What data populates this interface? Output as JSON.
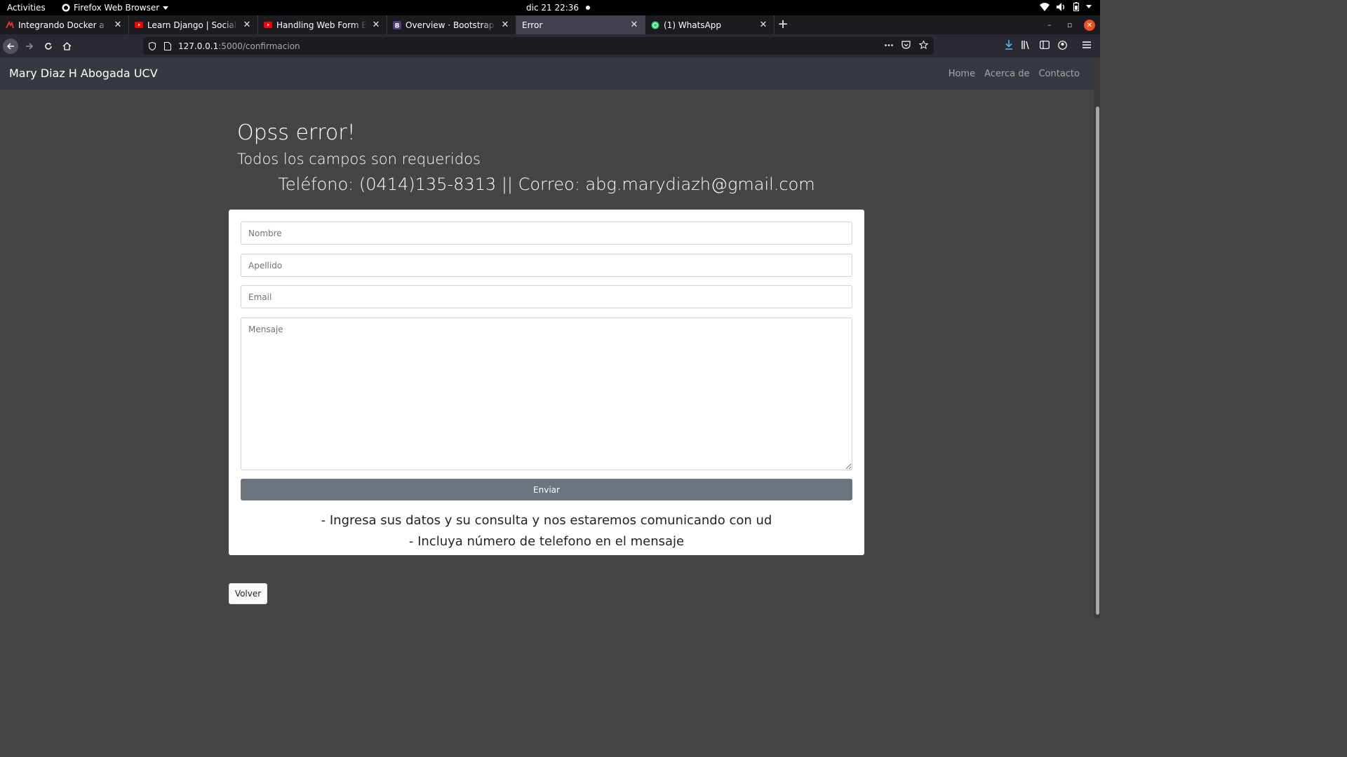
{
  "system": {
    "activities": "Activities",
    "app_name": "Firefox Web Browser",
    "clock": "dic 21  22:36"
  },
  "tabs": [
    {
      "title": "Integrando Docker a su I",
      "favicon": "c-red-logo-icon",
      "active": false
    },
    {
      "title": "Learn Django | Social Ne",
      "favicon": "youtube-icon",
      "active": false
    },
    {
      "title": "Handling Web Form Erro",
      "favicon": "youtube-icon",
      "active": false
    },
    {
      "title": "Overview · Bootstrap",
      "favicon": "bootstrap-icon",
      "active": false
    },
    {
      "title": "Error",
      "favicon": "",
      "active": true
    },
    {
      "title": "(1) WhatsApp",
      "favicon": "whatsapp-icon",
      "active": false
    }
  ],
  "url": {
    "host": "127.0.0.1",
    "path": ":5000/confirmacion"
  },
  "site": {
    "brand": "Mary Diaz H Abogada UCV",
    "links": [
      "Home",
      "Acerca de",
      "Contacto"
    ]
  },
  "error": {
    "title": "Opss error!",
    "subtitle": "Todos los campos son requeridos"
  },
  "contact_line": "Teléfono: (0414)135-8313 || Correo: abg.marydiazh@gmail.com",
  "form": {
    "nombre_placeholder": "Nombre",
    "apellido_placeholder": "Apellido",
    "email_placeholder": "Email",
    "mensaje_placeholder": "Mensaje",
    "submit_label": "Enviar"
  },
  "notes": [
    "- Ingresa sus datos y su consulta y nos estaremos comunicando con ud",
    "- Incluya número de telefono en el mensaje"
  ],
  "back_label": "Volver",
  "colors": {
    "page_bg": "#464543",
    "nav_bg": "#343a40",
    "button_secondary": "#6c757d",
    "ubuntu_close": "#e95420"
  }
}
